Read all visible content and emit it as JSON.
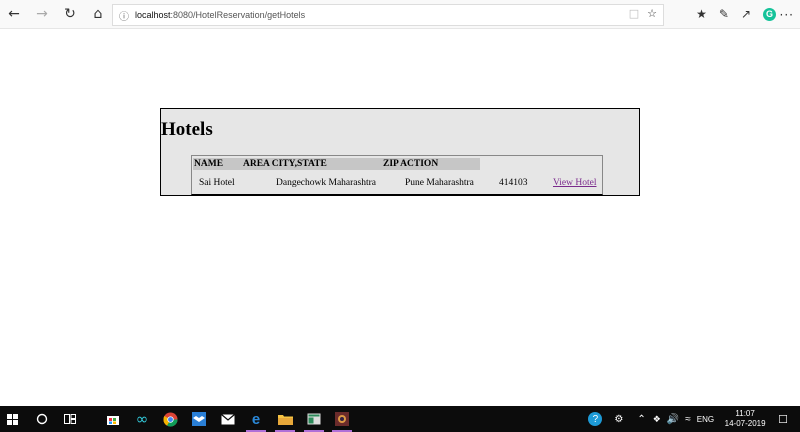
{
  "browser": {
    "url_host": "localhost",
    "url_rest": ":8080/HotelReservation/getHotels",
    "back_icon": "back-arrow-icon",
    "forward_icon": "forward-arrow-icon",
    "refresh_icon": "refresh-icon",
    "home_icon": "home-icon"
  },
  "page": {
    "title": "Hotels",
    "table": {
      "headers": [
        "NAME",
        "AREA",
        "CITY,STATE",
        "ZIP",
        "ACTION"
      ],
      "rows": [
        {
          "name": "Sai Hotel",
          "area": "Dangechowk",
          "area_state": "Maharashtra",
          "city_state": "Pune Maharashtra",
          "zip": "414103",
          "action": "View Hotel"
        }
      ]
    }
  },
  "taskbar": {
    "lang": "ENG",
    "time": "11:07",
    "date": "14-07-2019"
  }
}
